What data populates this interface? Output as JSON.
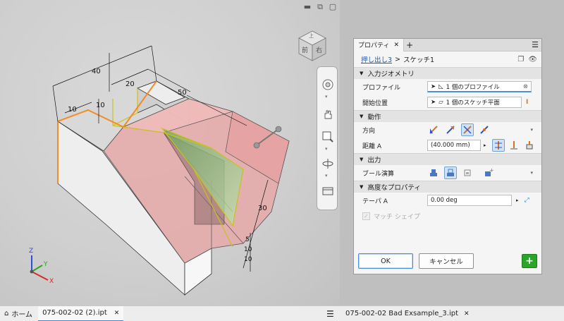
{
  "viewport": {
    "dimensions": [
      "40",
      "20",
      "50",
      "10",
      "10",
      "30",
      "5",
      "10",
      "10"
    ],
    "viewcube": {
      "front": "前",
      "right": "右",
      "top": "上"
    },
    "triad": {
      "x": "X",
      "y": "Y",
      "z": "Z"
    },
    "navbar_icons": [
      "steering-wheel-icon",
      "pan-icon",
      "zoom-window-icon",
      "orbit-icon",
      "view-face-icon"
    ]
  },
  "panel": {
    "tab_title": "プロパティ",
    "tab_close": "✕",
    "tab_add": "+",
    "menu": "☰",
    "breadcrumb": {
      "feature": "押し出し3",
      "separator": ">",
      "sketch": "スケッチ1"
    },
    "sections": {
      "input_geometry": "入力ジオメトリ",
      "behavior": "動作",
      "output": "出力",
      "advanced": "高度なプロパティ"
    },
    "rows": {
      "profile_label": "プロファイル",
      "profile_value": "1 個のプロファイル",
      "start_label": "開始位置",
      "start_value": "1 個のスケッチ平面",
      "direction_label": "方向",
      "distance_label": "距離 A",
      "distance_value": "(40.000 mm)",
      "boolean_label": "ブール演算",
      "taper_label": "テーパ A",
      "taper_value": "0.00 deg",
      "match_shape_label": "マッチ シェイプ"
    },
    "buttons": {
      "ok": "OK",
      "cancel": "キャンセル",
      "add": "+"
    }
  },
  "statusbar": {
    "home": "ホーム",
    "doc1": "075-002-02 (2).ipt",
    "doc2": "075-002-02 Bad Exsample_3.ipt",
    "close": "✕",
    "menu": "☰"
  },
  "colors": {
    "accent": "#3b86d6",
    "edge_orange": "#f28c28",
    "preview_red": "#e9a3a3",
    "preview_green": "#9fd18b",
    "add_green": "#2aa52a"
  }
}
